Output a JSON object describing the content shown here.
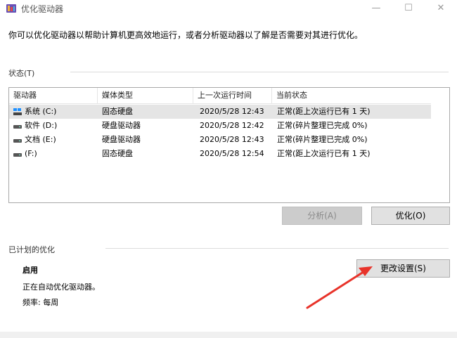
{
  "window": {
    "title": "优化驱动器",
    "minimize": "—",
    "maximize": "☐",
    "close": "✕"
  },
  "intro": "你可以优化驱动器以帮助计算机更高效地运行，或者分析驱动器以了解是否需要对其进行优化。",
  "status_section": {
    "label": "状态(T)"
  },
  "table": {
    "headers": [
      "驱动器",
      "媒体类型",
      "上一次运行时间",
      "当前状态"
    ],
    "rows": [
      {
        "drive": "系统 (C:)",
        "media": "固态硬盘",
        "time": "2020/5/28 12:43",
        "status": "正常(距上次运行已有 1 天)",
        "icon": "system-drive-icon",
        "selected": true
      },
      {
        "drive": "软件 (D:)",
        "media": "硬盘驱动器",
        "time": "2020/5/28 12:42",
        "status": "正常(碎片整理已完成 0%)",
        "icon": "hard-drive-icon",
        "selected": false
      },
      {
        "drive": "文档 (E:)",
        "media": "硬盘驱动器",
        "time": "2020/5/28 12:43",
        "status": "正常(碎片整理已完成 0%)",
        "icon": "hard-drive-icon",
        "selected": false
      },
      {
        "drive": "(F:)",
        "media": "固态硬盘",
        "time": "2020/5/28 12:54",
        "status": "正常(距上次运行已有 1 天)",
        "icon": "hard-drive-icon",
        "selected": false
      }
    ]
  },
  "buttons": {
    "analyze": "分析(A)",
    "optimize": "优化(O)",
    "change_settings": "更改设置(S)"
  },
  "scheduled": {
    "label": "已计划的优化",
    "status": "启用",
    "description": "正在自动优化驱动器。",
    "frequency": "频率: 每周"
  },
  "colors": {
    "annotation_arrow": "#e8332a",
    "selected_row": "#e5e5e5",
    "disabled_button": "#cccccc"
  }
}
